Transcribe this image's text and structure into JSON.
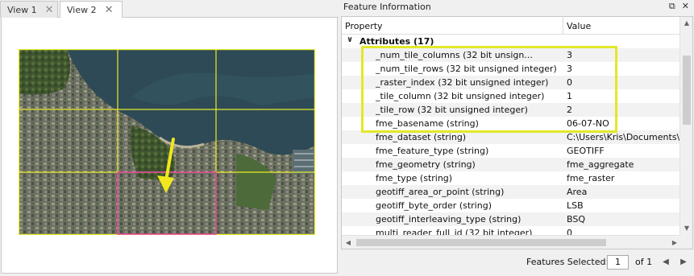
{
  "view_tabs": [
    {
      "label": "View 1",
      "close": "✕"
    },
    {
      "label": "View 2",
      "close": "✕"
    }
  ],
  "panel": {
    "title": "Feature Information",
    "restore_icon": "restore-window-icon",
    "close_icon": "close-icon"
  },
  "table": {
    "col_property": "Property",
    "col_value": "Value",
    "group": "Attributes (17)",
    "rows": [
      {
        "property": "_num_tile_columns (32 bit unsign...",
        "value": "3"
      },
      {
        "property": "_num_tile_rows (32 bit unsigned integer)",
        "value": "3"
      },
      {
        "property": "_raster_index (32 bit unsigned integer)",
        "value": "0"
      },
      {
        "property": "_tile_column (32 bit unsigned integer)",
        "value": "1"
      },
      {
        "property": "_tile_row (32 bit unsigned integer)",
        "value": "2"
      },
      {
        "property": "fme_basename (string)",
        "value": "06-07-NO"
      },
      {
        "property": "fme_dataset (string)",
        "value": "C:\\Users\\Kris\\Documents\\"
      },
      {
        "property": "fme_feature_type (string)",
        "value": "GEOTIFF"
      },
      {
        "property": "fme_geometry (string)",
        "value": "fme_aggregate"
      },
      {
        "property": "fme_type (string)",
        "value": "fme_raster"
      },
      {
        "property": "geotiff_area_or_point (string)",
        "value": "Area"
      },
      {
        "property": "geotiff_byte_order (string)",
        "value": "LSB"
      },
      {
        "property": "geotiff_interleaving_type (string)",
        "value": "BSQ"
      },
      {
        "property": "multi_reader_full_id (32 bit integer)",
        "value": "0"
      }
    ]
  },
  "footer": {
    "label": "Features Selected:",
    "current": "1",
    "of_total": "of 1"
  },
  "colors": {
    "grid_line": "#e8ea2a",
    "selected_tile": "#e83fa0",
    "arrow": "#f0e81c",
    "highlight_box": "#e2e82a"
  }
}
